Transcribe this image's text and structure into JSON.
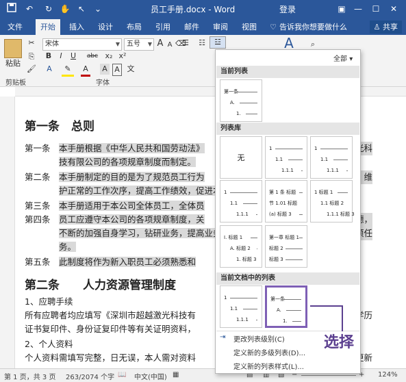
{
  "title_bar": {
    "doc_title": "员工手册.docx - Word",
    "login": "登录",
    "qat_icons": [
      "save-icon",
      "undo-icon",
      "redo-icon",
      "touch-icon",
      "pointer-icon",
      "customize-icon"
    ]
  },
  "tabs": [
    "文件",
    "开始",
    "插入",
    "设计",
    "布局",
    "引用",
    "邮件",
    "审阅",
    "视图"
  ],
  "tell_me": "告诉我你想要做什么",
  "share": "共享",
  "ribbon": {
    "paste": "粘贴",
    "font_name": "宋体",
    "font_size": "五号",
    "font_size_grow": "A",
    "font_size_shrink": "A",
    "format_btns": [
      "B",
      "I",
      "U",
      "abc",
      "x₂",
      "x²"
    ],
    "clipboard_label": "剪贴板",
    "font_label": "字体",
    "styles_glyph": "A"
  },
  "document": {
    "lines": [
      {
        "text": "第一条　总则",
        "type": "heading"
      },
      {
        "prefix": "第一条　",
        "text": "本手册根据《中华人民共和国劳动法》",
        "tail": "越激光科",
        "hl": true
      },
      {
        "prefix": "　　　　",
        "text": "技有限公司的各项规章制度而制定。",
        "tail": "",
        "hl": true
      },
      {
        "prefix": "第二条　",
        "text": "本手册制定的目的是为了规范员工行为",
        "tail": "造性，维",
        "hl": true
      },
      {
        "prefix": "　　　　",
        "text": "护正常的工作次序，提高工作绩效，促进本",
        "tail": "",
        "hl": true
      },
      {
        "prefix": "第三条　",
        "text": "本手册适用于本公司全体员工，全体员",
        "tail": "",
        "hl": true
      },
      {
        "prefix": "第四条　",
        "text": "员工应遵守本公司的各项规章制度，关",
        "tail": "业道德，",
        "hl": true
      },
      {
        "prefix": "　　　　",
        "text": "不断的加强自身学习，钻研业务，提高业务",
        "tail": "成各项任",
        "hl": true
      },
      {
        "prefix": "　　　　",
        "text": "务。",
        "tail": "",
        "hl": true
      },
      {
        "prefix": "第五条　",
        "text": "此制度将作为新入职员工必须熟悉和",
        "tail": "",
        "hl": true
      },
      {
        "text": "第二条　　人力资源管理制度",
        "type": "heading"
      },
      {
        "prefix": "",
        "text": "1、应聘手续",
        "tail": "",
        "hl": false
      },
      {
        "prefix": "",
        "text": "所有应聘者均应填写《深圳市超越激光科技有",
        "tail": "历，学历",
        "hl": false
      },
      {
        "prefix": "",
        "text": "证书复印件、身份证复印件等有关证明资料，",
        "tail": "",
        "hl": false
      },
      {
        "prefix": "",
        "text": "2、个人资料",
        "tail": "",
        "hl": false
      },
      {
        "prefix": "",
        "text": "个人资料需填写完整，日无误，本人需对资料",
        "tail": "表达更新",
        "hl": false
      }
    ]
  },
  "dropdown": {
    "filter": "全部",
    "sections": [
      "当前列表",
      "列表库",
      "当前文档中的列表"
    ],
    "current_list": [
      {
        "num": "第一条",
        "indent": 0
      },
      {
        "num": "A.",
        "indent": 1
      },
      {
        "num": "1.",
        "indent": 2
      }
    ],
    "library": [
      {
        "name": "无",
        "none": true
      },
      {
        "rows": [
          {
            "num": "1",
            "indent": 0
          },
          {
            "num": "1.1",
            "indent": 1
          },
          {
            "num": "1.1.1",
            "indent": 2
          }
        ]
      },
      {
        "rows": [
          {
            "num": "1",
            "indent": 0
          },
          {
            "num": "1.1",
            "indent": 1
          },
          {
            "num": "1.1.1",
            "indent": 2
          }
        ]
      },
      {
        "rows": [
          {
            "num": "1",
            "indent": 0
          },
          {
            "num": "1.1",
            "indent": 1
          },
          {
            "num": "1.1.1",
            "indent": 2
          }
        ]
      },
      {
        "rows": [
          {
            "num": "第 1 条 标题",
            "indent": 0
          },
          {
            "num": "节 1.01 标题",
            "indent": 0
          },
          {
            "num": "(a) 标题 3",
            "indent": 0
          }
        ]
      },
      {
        "rows": [
          {
            "num": "1 标题 1",
            "indent": 0
          },
          {
            "num": "1.1 标题 2",
            "indent": 1
          },
          {
            "num": "1.1.1 标题 3",
            "indent": 2
          }
        ]
      },
      {
        "rows": [
          {
            "num": "I. 标题 1",
            "indent": 0
          },
          {
            "num": "A. 标题 2",
            "indent": 1
          },
          {
            "num": "1. 标题 3",
            "indent": 2
          }
        ]
      },
      {
        "rows": [
          {
            "num": "第一章 标题 1",
            "indent": 0
          },
          {
            "num": "标题 2",
            "indent": 0
          },
          {
            "num": "标题 3",
            "indent": 0
          }
        ]
      }
    ],
    "doc_lists": [
      {
        "rows": [
          {
            "num": "1",
            "indent": 0
          },
          {
            "num": "1.1",
            "indent": 1
          },
          {
            "num": "1.1.1",
            "indent": 2
          }
        ]
      },
      {
        "rows": [
          {
            "num": "第一条",
            "indent": 0
          },
          {
            "num": "A.",
            "indent": 1
          },
          {
            "num": "1.",
            "indent": 2
          }
        ]
      }
    ],
    "menu": [
      {
        "label": "更改列表级别(C)",
        "disabled": false
      },
      {
        "label": "定义新的多级列表(D)...",
        "disabled": false
      },
      {
        "label": "定义新的列表样式(L)...",
        "disabled": false
      }
    ]
  },
  "callout": "选择",
  "status": {
    "page": "第 1 页，共 3 页",
    "words": "263/2074 个字",
    "lang": "中文(中国)",
    "zoom": "124%"
  },
  "colors": {
    "brand": "#2b579a",
    "highlight": "#d9d9d9",
    "callout": "#5b3f8f"
  }
}
